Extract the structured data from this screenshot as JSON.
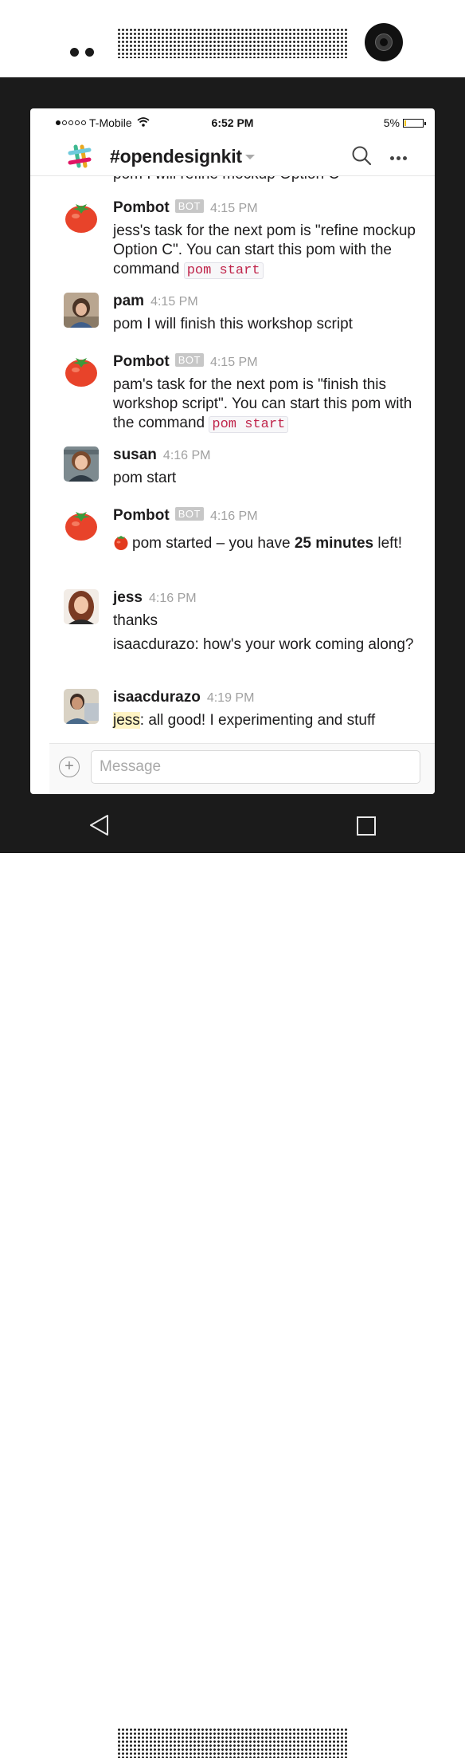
{
  "status_bar": {
    "carrier": "T-Mobile",
    "time": "6:52 PM",
    "battery": "5%"
  },
  "header": {
    "channel": "#opendesignkit"
  },
  "partial_top_line": "pom I will refine mockup Option C",
  "messages": [
    {
      "author": "Pombot",
      "bot_badge": "BOT",
      "time": "4:15 PM",
      "avatar": "tomato-icon",
      "parts": [
        "jess's task for the next pom is \"refine mockup Option C\". You can start this pom with the command ",
        "pom start"
      ]
    },
    {
      "author": "pam",
      "time": "4:15 PM",
      "avatar": "pam-photo",
      "text": "pom I will finish this workshop script"
    },
    {
      "author": "Pombot",
      "bot_badge": "BOT",
      "time": "4:15 PM",
      "avatar": "tomato-icon",
      "parts": [
        "pam's task for the next pom is \"finish this workshop script\". You can start this pom with the command ",
        "pom start"
      ]
    },
    {
      "author": "susan",
      "time": "4:16 PM",
      "avatar": "susan-photo",
      "text": "pom start"
    },
    {
      "author": "Pombot",
      "bot_badge": "BOT",
      "time": "4:16 PM",
      "avatar": "tomato-icon",
      "parts": [
        "pom started – you have ",
        "25 minutes",
        " left!"
      ]
    },
    {
      "author": "jess",
      "time": "4:16 PM",
      "avatar": "jess-photo",
      "lines": [
        "thanks",
        "isaacdurazo: how's your work coming along?"
      ]
    },
    {
      "author": "isaacdurazo",
      "time": "4:19 PM",
      "avatar": "isaac-photo",
      "mention": "jess",
      "text": ": all good! I experimenting and stuff"
    }
  ],
  "composer": {
    "placeholder": "Message"
  },
  "colors": {
    "phone_frame": "#1b1b1b",
    "code_text": "#c0254b",
    "mention_bg": "#fff4c4",
    "bot_badge_bg": "#c7c7c7"
  }
}
